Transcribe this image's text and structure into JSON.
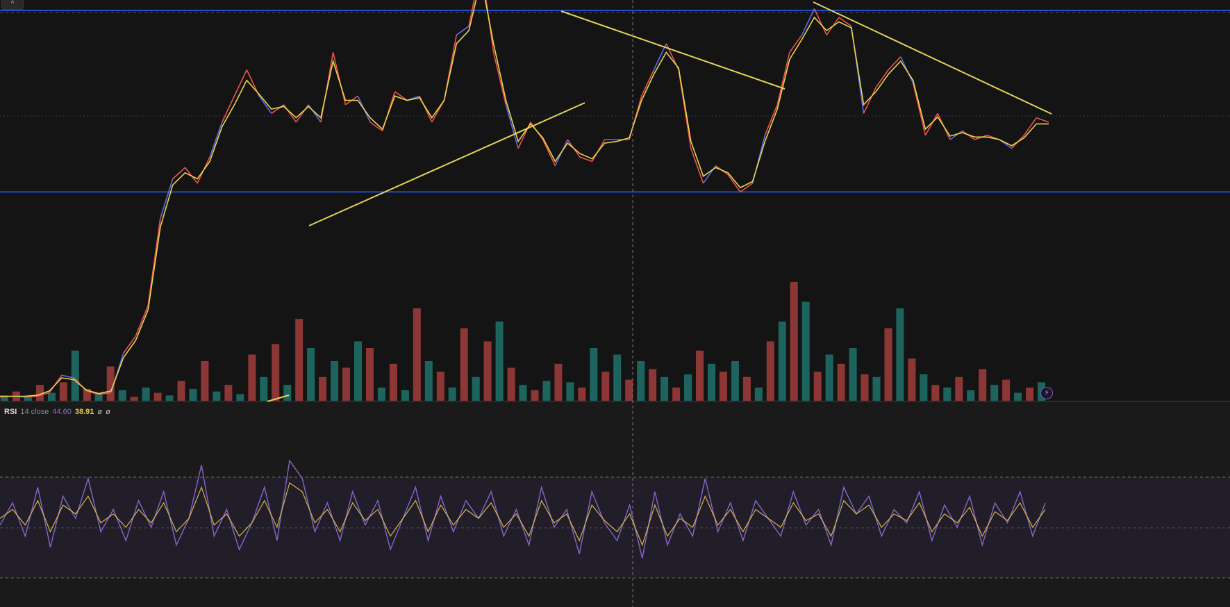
{
  "chart": {
    "collapse_label": "^",
    "replay_label": "⚡",
    "colors": {
      "background": "#141414",
      "pane_background": "#1a1a1a",
      "price_line": "#ef5350",
      "price_line_alt": "#5b6cf0",
      "ma_line": "#e9d64a",
      "trendline": "#e6d35a",
      "horizontal_level": "#2962ff",
      "volume_up": "#26a69a",
      "volume_down": "#ef5350",
      "rsi_line": "#8c6bd1",
      "rsi_ma": "#e6c64a",
      "rsi_band": "#2a2336",
      "crosshair": "#7a7a7a"
    }
  },
  "chart_data": [
    {
      "type": "line",
      "pane": "price",
      "series": [
        {
          "values": [
            5,
            6,
            5,
            6,
            10,
            30,
            27,
            12,
            8,
            10,
            55,
            75,
            110,
            210,
            255,
            268,
            250,
            280,
            320,
            350,
            380,
            350,
            330,
            340,
            320,
            340,
            320,
            400,
            340,
            350,
            320,
            310,
            355,
            345,
            350,
            320,
            345,
            420,
            430,
            500,
            400,
            340,
            290,
            320,
            300,
            270,
            300,
            280,
            275,
            300,
            300,
            300,
            350,
            380,
            410,
            380,
            290,
            250,
            270,
            260,
            240,
            250,
            305,
            340,
            400,
            420,
            450,
            420,
            440,
            430,
            330,
            360,
            380,
            395,
            365,
            305,
            330,
            300,
            310,
            300,
            305,
            300,
            290,
            305,
            325,
            320
          ]
        },
        {
          "values": [
            6,
            6,
            6,
            7,
            12,
            27,
            25,
            13,
            9,
            12,
            50,
            70,
            105,
            200,
            248,
            262,
            255,
            275,
            315,
            340,
            368,
            352,
            335,
            338,
            325,
            338,
            325,
            390,
            345,
            345,
            325,
            312,
            350,
            345,
            348,
            325,
            345,
            410,
            425,
            485,
            410,
            345,
            298,
            318,
            302,
            275,
            296,
            284,
            278,
            296,
            298,
            302,
            345,
            375,
            400,
            382,
            298,
            258,
            268,
            262,
            245,
            252,
            298,
            335,
            392,
            415,
            440,
            425,
            435,
            428,
            340,
            355,
            375,
            390,
            368,
            312,
            326,
            304,
            308,
            303,
            303,
            300,
            293,
            302,
            318,
            318
          ]
        }
      ],
      "levels": [
        448,
        240
      ]
    },
    {
      "type": "bar",
      "pane": "volume",
      "values": [
        4,
        7,
        3,
        12,
        6,
        14,
        38,
        9,
        5,
        26,
        8,
        3,
        10,
        6,
        4,
        15,
        9,
        30,
        7,
        12,
        5,
        35,
        18,
        43,
        12,
        62,
        40,
        18,
        30,
        25,
        45,
        40,
        10,
        28,
        8,
        70,
        30,
        22,
        10,
        55,
        18,
        45,
        60,
        25,
        12,
        8,
        15,
        28,
        14,
        10,
        40,
        22,
        35,
        16,
        30,
        24,
        18,
        10,
        20,
        38,
        28,
        22,
        30,
        18,
        10,
        45,
        60,
        90,
        75,
        22,
        35,
        28,
        40,
        20,
        18,
        55,
        70,
        32,
        20,
        12,
        10,
        18,
        8,
        24,
        12,
        16,
        6,
        10,
        14
      ]
    },
    {
      "type": "line",
      "pane": "rsi",
      "series": [
        {
          "values": [
            45,
            55,
            40,
            62,
            35,
            58,
            48,
            66,
            42,
            52,
            38,
            56,
            44,
            60,
            36,
            48,
            72,
            40,
            52,
            34,
            46,
            62,
            38,
            74,
            66,
            42,
            55,
            38,
            60,
            45,
            56,
            34,
            48,
            62,
            38,
            58,
            42,
            56,
            48,
            60,
            40,
            52,
            36,
            62,
            44,
            52,
            32,
            60,
            46,
            38,
            54,
            30,
            60,
            36,
            50,
            40,
            66,
            42,
            55,
            38,
            56,
            48,
            40,
            60,
            45,
            52,
            36,
            62,
            50,
            58,
            40,
            52,
            46,
            60,
            38,
            54,
            44,
            58,
            36,
            55,
            46,
            60,
            40,
            55
          ]
        },
        {
          "values": [
            48,
            52,
            45,
            56,
            42,
            54,
            50,
            58,
            46,
            50,
            44,
            52,
            46,
            55,
            42,
            48,
            62,
            45,
            50,
            40,
            46,
            56,
            44,
            64,
            60,
            46,
            52,
            42,
            55,
            47,
            52,
            40,
            48,
            56,
            42,
            54,
            45,
            52,
            48,
            55,
            44,
            50,
            40,
            56,
            46,
            50,
            38,
            54,
            47,
            42,
            50,
            36,
            54,
            40,
            48,
            44,
            58,
            45,
            52,
            42,
            52,
            48,
            44,
            55,
            47,
            50,
            40,
            56,
            50,
            54,
            44,
            50,
            47,
            55,
            42,
            50,
            46,
            53,
            40,
            51,
            47,
            55,
            44,
            52
          ]
        }
      ],
      "levels": [
        70,
        30
      ],
      "legend": {
        "name": "RSI",
        "params": "14 close",
        "value_1": "44.60",
        "value_2": "38.91",
        "na_1": "ø",
        "na_2": "ø"
      }
    }
  ]
}
